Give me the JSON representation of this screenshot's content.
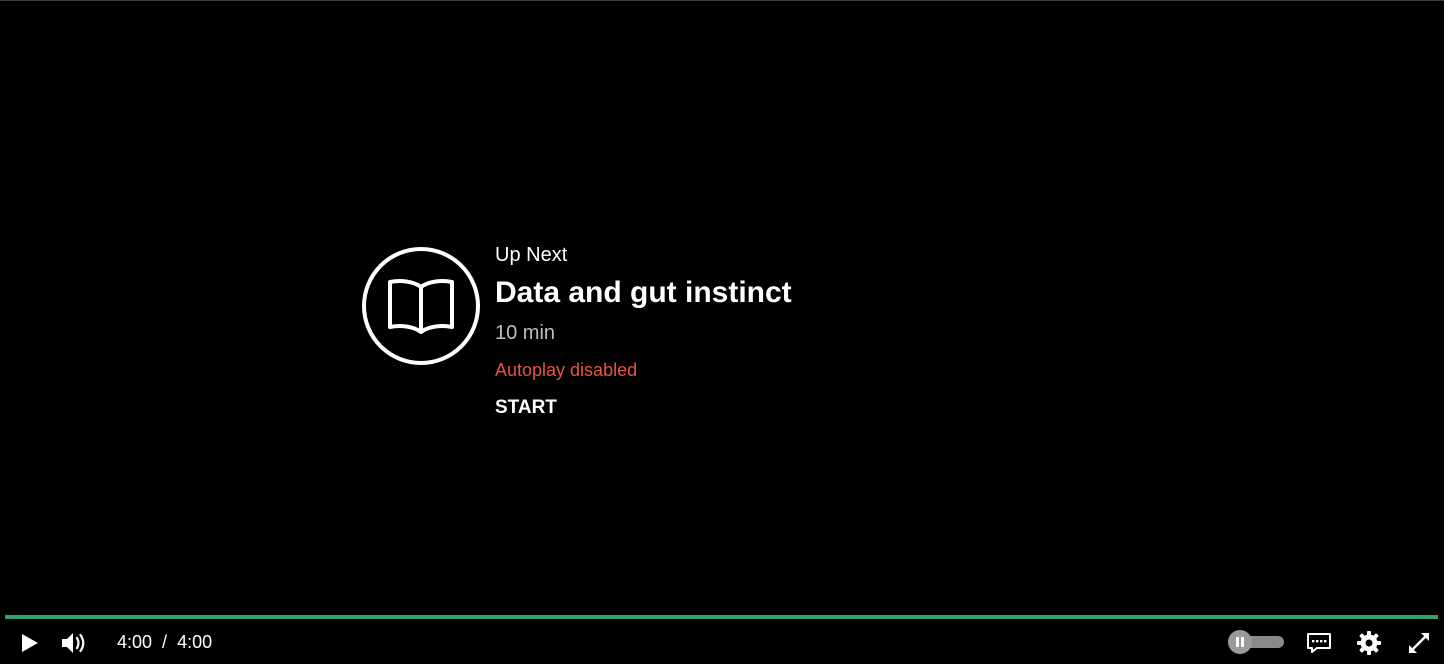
{
  "up_next": {
    "label": "Up Next",
    "title": "Data and gut instinct",
    "duration": "10 min",
    "autoplay_status": "Autoplay disabled",
    "start_label": "START",
    "icon": "open-book-icon"
  },
  "player": {
    "current_time": "4:00",
    "separator": "/",
    "total_time": "4:00",
    "progress_fraction": 1.0,
    "autoplay_enabled": false
  },
  "controls": {
    "play_icon": "play-icon",
    "volume_icon": "volume-icon",
    "autoplay_toggle_icon": "pause-icon",
    "captions_icon": "captions-icon",
    "settings_icon": "gear-icon",
    "fullscreen_icon": "fullscreen-icon"
  },
  "colors": {
    "background": "#000000",
    "progress": "#2fa36a",
    "autoplay_status": "#e8553b",
    "text": "#ffffff"
  }
}
